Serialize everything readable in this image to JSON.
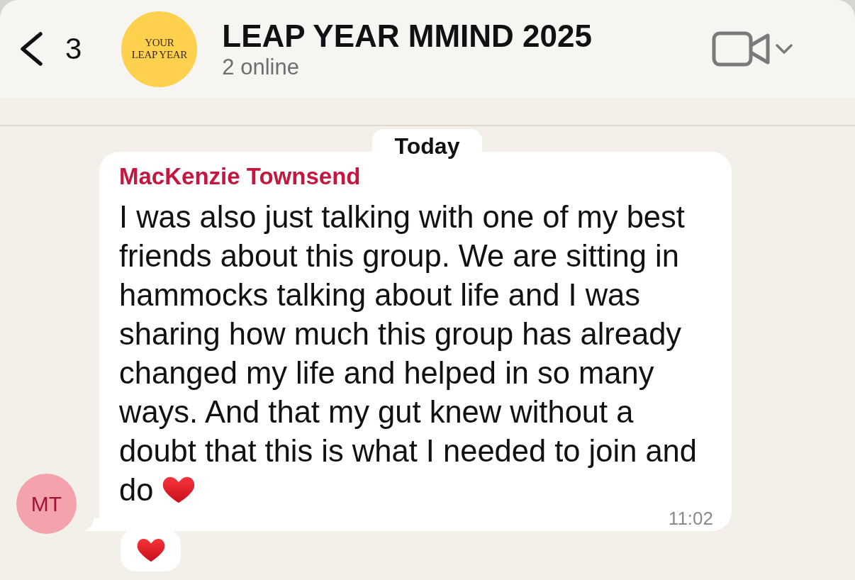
{
  "header": {
    "back_count": "3",
    "group": {
      "avatar_lines": [
        "YOUR",
        "LEAP YEAR"
      ],
      "name": "LEAP YEAR MMIND 2025",
      "status": "2 online"
    }
  },
  "date_pill": "Today",
  "messages": [
    {
      "sender": "MacKenzie Townsend",
      "avatar_initials": "MT",
      "text": "I was also just talking with one of my best friends about this group. We are sitting in hammocks talking about life and I was sharing how much this group has already changed my life and helped in so many ways. And that my gut knew without a doubt that this is what I needed to join and do",
      "emoji": [
        {
          "kind": "heart"
        }
      ],
      "time": "11:02",
      "reactions": [
        {
          "kind": "heart"
        }
      ]
    }
  ]
}
